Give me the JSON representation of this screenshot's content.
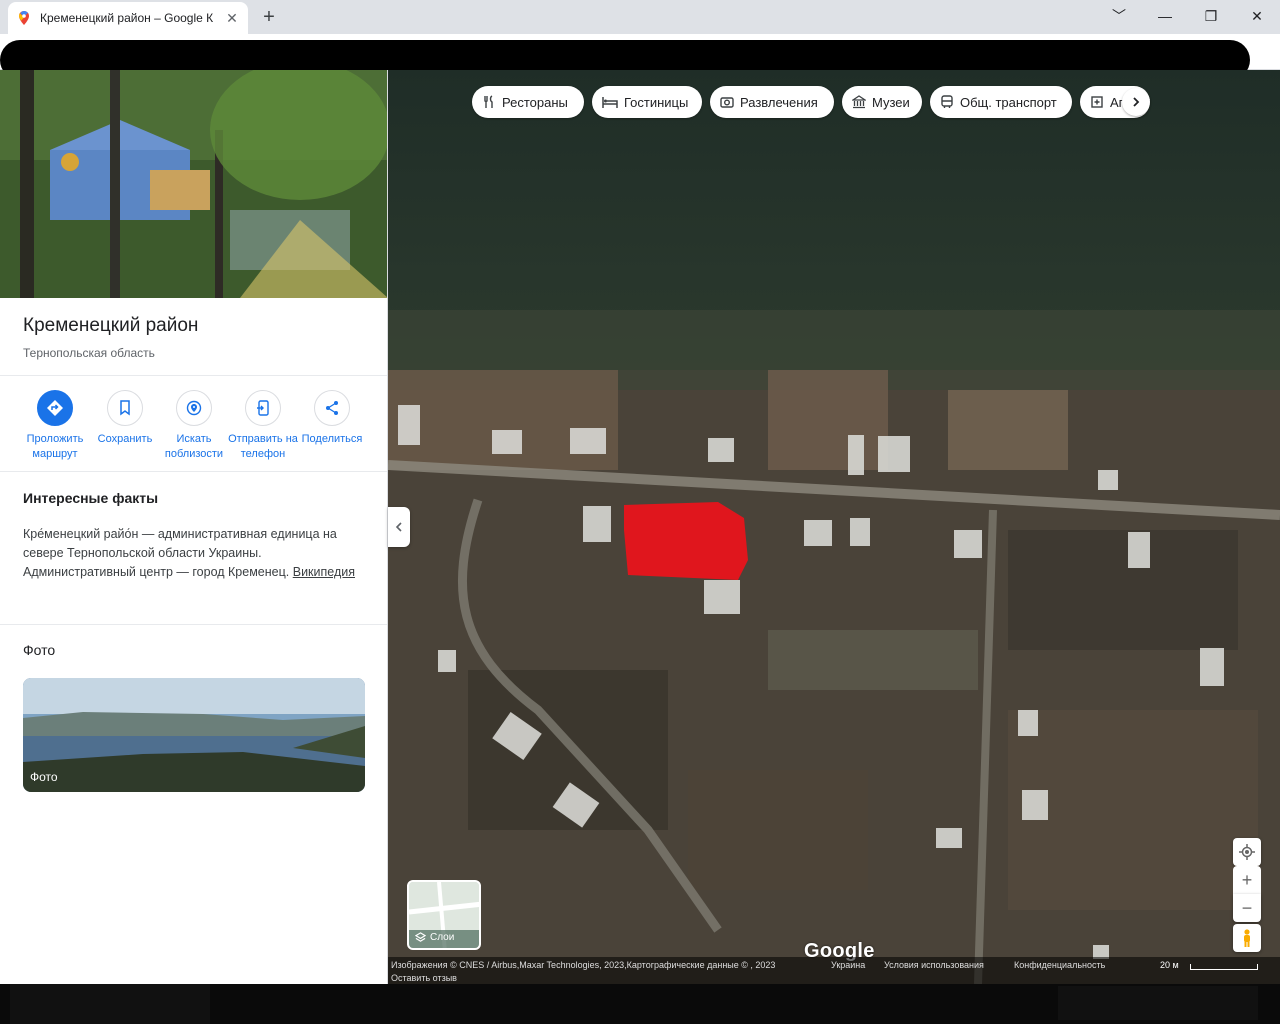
{
  "browser": {
    "tab_title": "Кременецкий район – Google К",
    "tab_close": "✕",
    "new_tab": "+",
    "minimize": "﹀",
    "restore": "—",
    "maximize": "❐",
    "close": "✕"
  },
  "panel": {
    "title": "Кременецкий район",
    "subtitle": "Тернопольская область",
    "actions": [
      {
        "label": "Проложить маршрут",
        "icon": "directions-icon"
      },
      {
        "label": "Сохранить",
        "icon": "bookmark-icon"
      },
      {
        "label": "Искать поблизости",
        "icon": "nearby-icon"
      },
      {
        "label": "Отправить на телефон",
        "icon": "send-to-phone-icon"
      },
      {
        "label": "Поделиться",
        "icon": "share-icon"
      }
    ],
    "facts_heading": "Интересные факты",
    "facts_text": "Кре́менецкий райо́н — административная единица на севере Тернопольской области Украины. Административный центр — город Кременец.",
    "facts_link": "Википедия",
    "photos_heading": "Фото",
    "photo_label": "Фото"
  },
  "map": {
    "chips": [
      {
        "label": "Рестораны",
        "icon": "restaurant-icon"
      },
      {
        "label": "Гостиницы",
        "icon": "hotel-icon"
      },
      {
        "label": "Развлечения",
        "icon": "camera-icon"
      },
      {
        "label": "Музеи",
        "icon": "museum-icon"
      },
      {
        "label": "Общ. транспорт",
        "icon": "transit-icon"
      },
      {
        "label": "Аптеки",
        "icon": "pharmacy-icon"
      }
    ],
    "layers_label": "Слои",
    "zoom_in": "+",
    "zoom_out": "−",
    "google_logo": "Google",
    "attribution": "Изображения © CNES / Airbus,Maxar Technologies, 2023,Картографические данные © , 2023",
    "country": "Украина",
    "terms": "Условия использования",
    "privacy": "Конфиденциальность",
    "scale": "20 м",
    "feedback": "Оставить отзыв"
  }
}
